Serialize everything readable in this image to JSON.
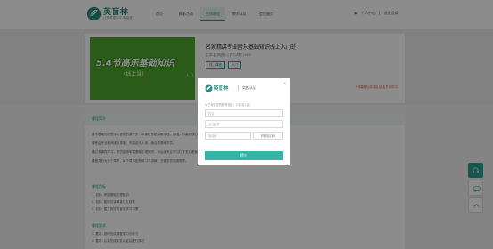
{
  "brand": {
    "name": "英盲林",
    "slogan": "让教育更公平 更高效"
  },
  "nav": {
    "items": [
      {
        "label": "首页",
        "active": false
      },
      {
        "label": "精彩活动",
        "active": false
      },
      {
        "label": "在线课程",
        "active": true
      },
      {
        "label": "教师认证",
        "active": false
      },
      {
        "label": "会员服务",
        "active": false
      }
    ]
  },
  "user": {
    "center": "个人中心",
    "logout": "退出登录"
  },
  "course": {
    "image_title": "5.4节高乐基础知识",
    "image_subtitle": "(线上课)",
    "image_tag": "入门",
    "title": "名家精讲专业音乐基础知识线上入门班",
    "meta": "主讲: 名师团队  |  学习人数 1680",
    "badges": [
      "线上课程",
      "入门"
    ],
    "note": "*本课程为实名认证后方可学习"
  },
  "content": {
    "tab_label": "课程简介",
    "paragraphs": [
      "音乐基础知识是学习音乐的第一步，本课程系统讲解乐理、视唱、节奏等核心内容，帮助学员快速入门。",
      "课程由专业教师团队录制，内容由浅入深，适合零基础学员。",
      "通过本课程学习，学员能够掌握基础乐理知识，为后续专业学习打下坚实基础。",
      "课程共分为多个章节，每个章节配有练习与讲解，方便学员巩固所学。"
    ],
    "section1_title": "课程目标",
    "section1_lines": [
      "1. 目标: 掌握基础乐理知识",
      "2. 目标: 能够识读简谱与五线谱",
      "3. 目标: 建立良好的音乐学习习惯"
    ],
    "section2_title": "课程要求",
    "section2_lines": [
      "1. 要求: 按时完成课程学习与练习",
      "2. 要求: 认真完成实名认证后进行学习"
    ]
  },
  "modal": {
    "brand": "英盲林",
    "title": "实名认证",
    "tip": "为了保证您的账号安全，请实名认证",
    "name_placeholder": "姓名",
    "id_placeholder": "身份证号",
    "code_placeholder": "验证码",
    "code_button": "获取验证码",
    "submit_label": "提交",
    "close_glyph": "×"
  },
  "colors": {
    "brand": "#2a9d8f",
    "submit": "#35b3a6"
  },
  "icons": {
    "side_top": "headset-icon",
    "side_mid": "chat-icon",
    "side_bot": "arrow-up-icon"
  }
}
